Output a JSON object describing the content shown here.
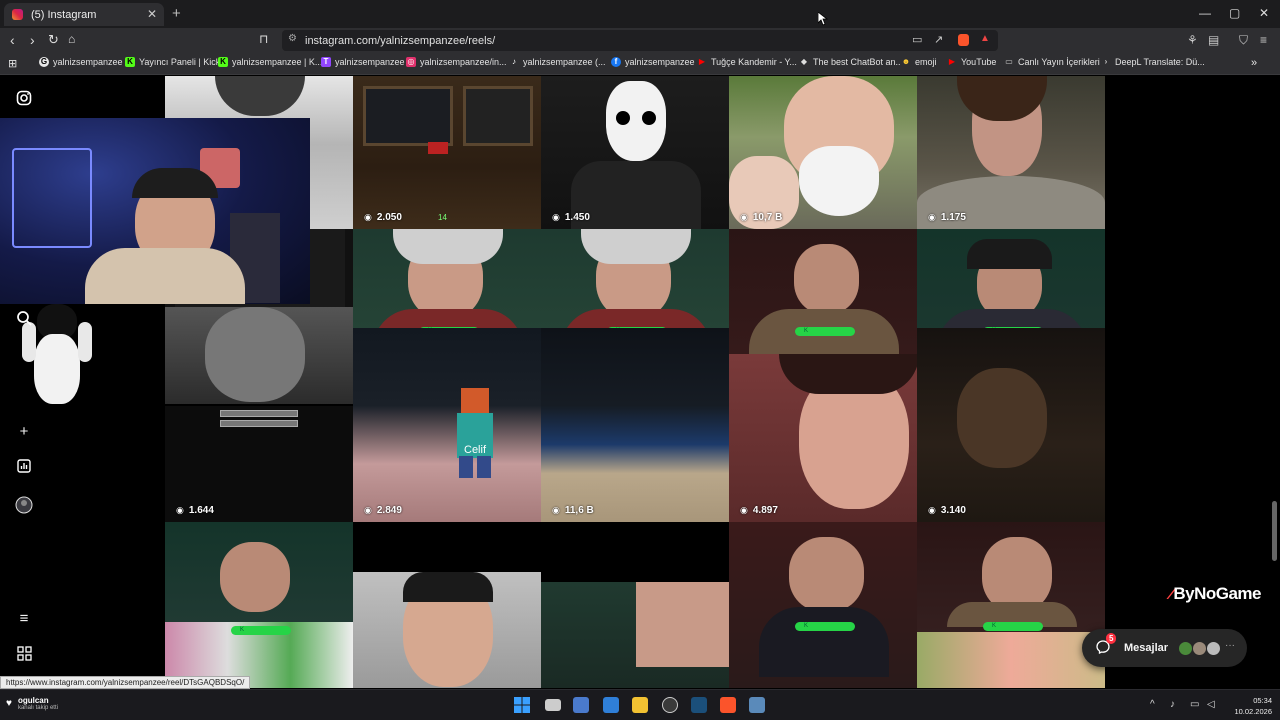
{
  "browser": {
    "tab_title": "(5) Instagram",
    "tab_close": "✕",
    "new_tab": "+",
    "url": "instagram.com/yalnizsempanzee/reels/",
    "window": {
      "minimize": "—",
      "maximize": "▢",
      "close": "✕"
    }
  },
  "bookmarks": [
    {
      "label": "yalnizsempanzee",
      "icon": "G",
      "color": "#e8e8e8"
    },
    {
      "label": "Yayıncı Paneli | Kick",
      "icon": "K",
      "color": "#53fc18"
    },
    {
      "label": "yalnizsempanzee | K...",
      "icon": "K",
      "color": "#53fc18"
    },
    {
      "label": "yalnizsempanzee",
      "icon": "T",
      "color": "#9146ff"
    },
    {
      "label": "yalnizsempanzee/in...",
      "icon": "◎",
      "color": "#e1306c"
    },
    {
      "label": "yalnizsempanzee (...",
      "icon": "♪",
      "color": "#ffffff"
    },
    {
      "label": "yalnizsempanzee",
      "icon": "f",
      "color": "#1877f2"
    },
    {
      "label": "Tuğçe Kandemir - Y...",
      "icon": "▶",
      "color": "#ff0000"
    },
    {
      "label": "The best ChatBot an...",
      "icon": "◆",
      "color": "#dddddd"
    },
    {
      "label": "emoji",
      "icon": "☻",
      "color": "#ffcc33"
    },
    {
      "label": "YouTube",
      "icon": "▶",
      "color": "#ff0000"
    },
    {
      "label": "Canlı Yayın İçerikleri",
      "icon": "▭",
      "color": "#cccccc"
    },
    {
      "label": "DeepL Translate: Dü...",
      "icon": "›",
      "color": "#cccccc"
    }
  ],
  "reels": [
    {
      "views": "2.050"
    },
    {
      "views": "1.450"
    },
    {
      "views": "10,7 B"
    },
    {
      "views": "1.175"
    },
    {
      "views": "1.644"
    },
    {
      "views": "2.849"
    },
    {
      "views": "11,6 B"
    },
    {
      "views": "4.897"
    },
    {
      "views": "3.140"
    }
  ],
  "overlay": {
    "player_name": "Celif",
    "brand": "ByNoGame",
    "brand_mark": "⁄",
    "mc_count": "14"
  },
  "messages": {
    "label": "Mesajlar",
    "badge": "5"
  },
  "status_url": "https://www.instagram.com/yalnizsempanzee/reel/DTsGAQBDSqO/",
  "taskbar": {
    "weather_title": "ogulcan",
    "weather_sub": "kanalı takip etti",
    "time": "05:34",
    "date": "10.02.2026"
  },
  "colors": {
    "kick_green": "#26d447",
    "instagram_bg": "#000000",
    "notification": "#ff3040"
  }
}
